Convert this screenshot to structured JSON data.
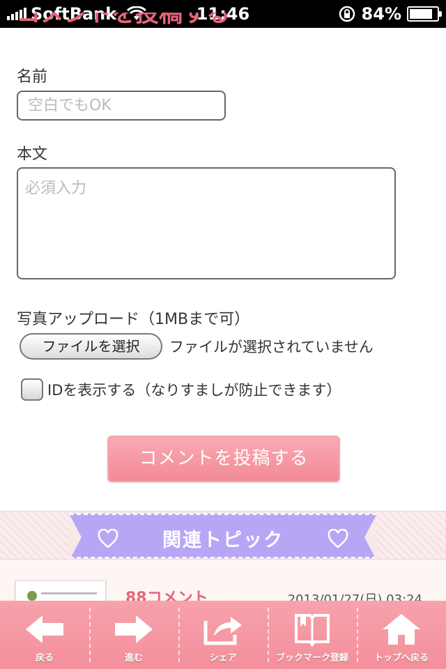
{
  "status_bar": {
    "carrier": "SoftBank",
    "time": "11:46",
    "battery_percent": "84%",
    "battery_level": 0.84
  },
  "form": {
    "section_title": "コメントを投稿する",
    "name_label": "名前",
    "name_placeholder": "空白でもOK",
    "body_label": "本文",
    "body_placeholder": "必須入力",
    "photo_label": "写真アップロード（1MBまで可）",
    "file_button_label": "ファイルを選択",
    "file_status": "ファイルが選択されていません",
    "show_id_label": "IDを表示する（なりすましが防止できます）",
    "show_id_checked": false,
    "submit_label": "コメントを投稿する"
  },
  "related": {
    "heading": "関連トピック",
    "accent_color": "#b7a6f5",
    "topic": {
      "comments": "88コメント",
      "date": "2013/01/27(日) 03:24"
    }
  },
  "toolbar": {
    "color": "#f48f9b",
    "items": [
      {
        "label": "戻る",
        "icon": "back-arrow-icon"
      },
      {
        "label": "進む",
        "icon": "forward-arrow-icon"
      },
      {
        "label": "シェア",
        "icon": "share-icon"
      },
      {
        "label": "ブックマーク登録",
        "icon": "bookmark-book-icon"
      },
      {
        "label": "トップへ戻る",
        "icon": "home-icon"
      }
    ]
  }
}
